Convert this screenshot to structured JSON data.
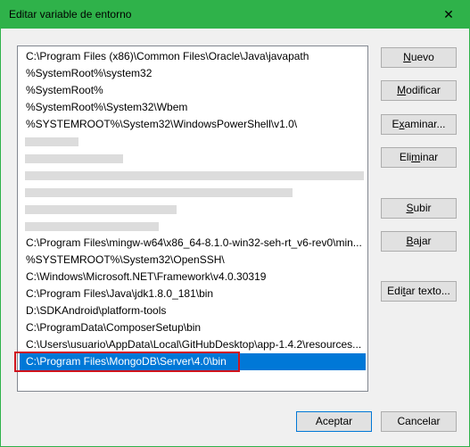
{
  "window": {
    "title": "Editar variable de entorno",
    "close_glyph": "✕"
  },
  "list": {
    "items": [
      {
        "text": "C:\\Program Files (x86)\\Common Files\\Oracle\\Java\\javapath",
        "state": "normal"
      },
      {
        "text": "%SystemRoot%\\system32",
        "state": "normal"
      },
      {
        "text": "%SystemRoot%",
        "state": "normal"
      },
      {
        "text": "%SystemRoot%\\System32\\Wbem",
        "state": "normal"
      },
      {
        "text": "%SYSTEMROOT%\\System32\\WindowsPowerShell\\v1.0\\",
        "state": "normal"
      },
      {
        "text": "",
        "state": "blurred"
      },
      {
        "text": "",
        "state": "blurred"
      },
      {
        "text": "",
        "state": "blurred"
      },
      {
        "text": "",
        "state": "blurred"
      },
      {
        "text": "",
        "state": "blurred"
      },
      {
        "text": "",
        "state": "blurred"
      },
      {
        "text": "C:\\Program Files\\mingw-w64\\x86_64-8.1.0-win32-seh-rt_v6-rev0\\min...",
        "state": "normal"
      },
      {
        "text": "%SYSTEMROOT%\\System32\\OpenSSH\\",
        "state": "normal"
      },
      {
        "text": "C:\\Windows\\Microsoft.NET\\Framework\\v4.0.30319",
        "state": "normal"
      },
      {
        "text": "C:\\Program Files\\Java\\jdk1.8.0_181\\bin",
        "state": "normal"
      },
      {
        "text": "D:\\SDKAndroid\\platform-tools",
        "state": "normal"
      },
      {
        "text": "C:\\ProgramData\\ComposerSetup\\bin",
        "state": "normal"
      },
      {
        "text": "C:\\Users\\usuario\\AppData\\Local\\GitHubDesktop\\app-1.4.2\\resources...",
        "state": "normal"
      },
      {
        "text": "C:\\Program Files\\MongoDB\\Server\\4.0\\bin",
        "state": "selected"
      }
    ]
  },
  "buttons": {
    "nuevo": {
      "label": "Nuevo",
      "underline_index": 0
    },
    "modificar": {
      "label": "Modificar",
      "underline_index": 0
    },
    "examinar": {
      "label": "Examinar...",
      "underline_index": 1
    },
    "eliminar": {
      "label": "Eliminar",
      "underline_index": 3
    },
    "subir": {
      "label": "Subir",
      "underline_index": 0
    },
    "bajar": {
      "label": "Bajar",
      "underline_index": 0
    },
    "editar_texto": {
      "label": "Editar texto...",
      "underline_index": 3
    },
    "aceptar": {
      "label": "Aceptar"
    },
    "cancelar": {
      "label": "Cancelar"
    }
  },
  "colors": {
    "titlebar": "#2fb24a",
    "selection": "#0078d7",
    "annotation_box": "#d0141d"
  }
}
